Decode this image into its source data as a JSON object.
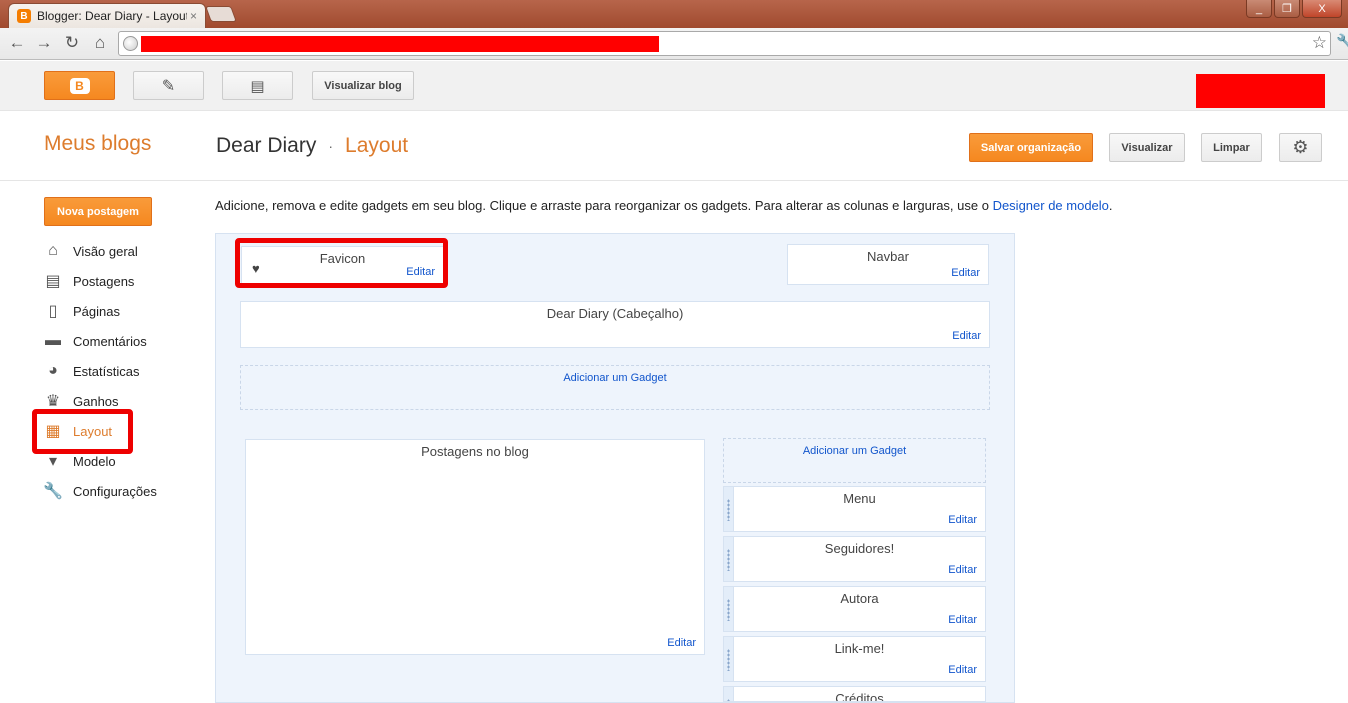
{
  "browser": {
    "tab_title": "Blogger: Dear Diary - Layout",
    "tab_close": "×",
    "win_min": "_",
    "win_max": "❐",
    "win_close": "X"
  },
  "topbar": {
    "visualizar_blog": "Visualizar blog"
  },
  "header": {
    "meus_blogs": "Meus blogs",
    "blog_name": "Dear Diary",
    "separator": "·",
    "section": "Layout",
    "save_label": "Salvar organização",
    "preview_label": "Visualizar",
    "clear_label": "Limpar"
  },
  "sidebar": {
    "new_post": "Nova postagem",
    "items": [
      {
        "label": "Visão geral",
        "icon": "home-icon"
      },
      {
        "label": "Postagens",
        "icon": "posts-icon"
      },
      {
        "label": "Páginas",
        "icon": "pages-icon"
      },
      {
        "label": "Comentários",
        "icon": "comments-icon"
      },
      {
        "label": "Estatísticas",
        "icon": "stats-icon"
      },
      {
        "label": "Ganhos",
        "icon": "trophy-icon"
      },
      {
        "label": "Layout",
        "icon": "layout-icon"
      },
      {
        "label": "Modelo",
        "icon": "template-icon"
      },
      {
        "label": "Configurações",
        "icon": "wrench-icon"
      }
    ]
  },
  "main": {
    "description": "Adicione, remova e edite gadgets em seu blog. Clique e arraste para reorganizar os gadgets. Para alterar as colunas e larguras, use o ",
    "designer_link": "Designer de modelo",
    "description_end": ".",
    "edit_label": "Editar",
    "add_gadget": "Adicionar um Gadget",
    "favicon": "Favicon",
    "navbar": "Navbar",
    "header_gadget": "Dear Diary (Cabeçalho)",
    "posts_gadget": "Postagens no blog",
    "sidebar_gadgets": [
      "Menu",
      "Seguidores!",
      "Autora",
      "Link-me!",
      "Créditos"
    ]
  },
  "colors": {
    "accent": "#f58820",
    "link": "#1155cc",
    "highlight": "#ee0000"
  }
}
